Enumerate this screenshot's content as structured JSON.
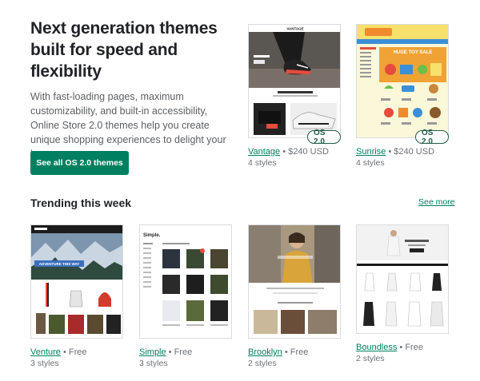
{
  "hero": {
    "title": "Next generation themes built for speed and flexibility",
    "description": "With fast-loading pages, maximum customizability, and built-in accessibility, Online Store 2.0 themes help you create unique shopping experiences to delight your buyers.",
    "cta_label": "See all OS 2.0 themes"
  },
  "featured": [
    {
      "name": "Vantage",
      "price": " • $240 USD",
      "styles": "4 styles",
      "badge": "OS 2.0",
      "thumb_brand": "VANTAGE"
    },
    {
      "name": "Sunrise",
      "price": " • $240 USD",
      "styles": "4 styles",
      "badge": "OS 2.0",
      "thumb_banner": "HUGE TOY SALE"
    }
  ],
  "trending": {
    "title": "Trending this week",
    "see_more": "See more",
    "items": [
      {
        "name": "Venture",
        "price": " • Free",
        "styles": "3 styles",
        "thumb_banner": "ADVENTURE THIS WAY"
      },
      {
        "name": "Simple",
        "price": " • Free",
        "styles": "3 styles",
        "thumb_brand": "Simple."
      },
      {
        "name": "Brooklyn",
        "price": " • Free",
        "styles": "2 styles"
      },
      {
        "name": "Boundless",
        "price": " • Free",
        "styles": "2 styles"
      }
    ]
  },
  "colors": {
    "accent": "#008060",
    "badge": "#1f5c47",
    "text": "#212326",
    "muted": "#6d7175"
  }
}
